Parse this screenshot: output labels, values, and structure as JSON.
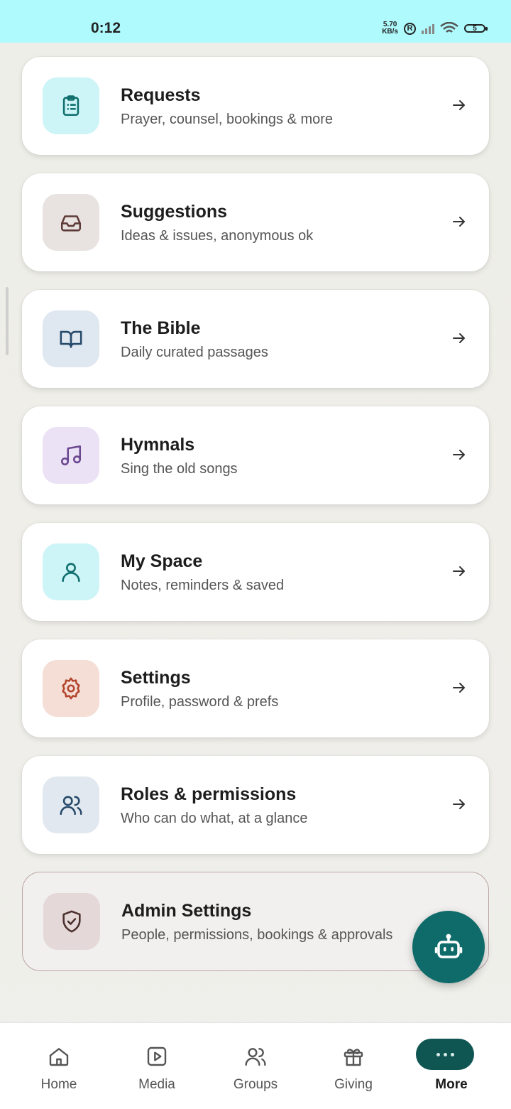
{
  "status_bar": {
    "time": "0:12",
    "speed_value": "5.70",
    "speed_unit": "KB/s",
    "r_badge": "R",
    "battery": "5"
  },
  "menu": [
    {
      "title": "Requests",
      "subtitle": "Prayer, counsel, bookings & more",
      "icon": "clipboard-icon",
      "tile_color": "#cdf4f7",
      "icon_color": "#0f6f6d"
    },
    {
      "title": "Suggestions",
      "subtitle": "Ideas & issues, anonymous ok",
      "icon": "inbox-icon",
      "tile_color": "#e8e3e1",
      "icon_color": "#5d3a37"
    },
    {
      "title": "The Bible",
      "subtitle": "Daily curated passages",
      "icon": "book-icon",
      "tile_color": "#dfe7f0",
      "icon_color": "#274a6b"
    },
    {
      "title": "Hymnals",
      "subtitle": "Sing the old songs",
      "icon": "music-note-icon",
      "tile_color": "#ebe2f5",
      "icon_color": "#6b4790"
    },
    {
      "title": "My Space",
      "subtitle": "Notes, reminders & saved",
      "icon": "user-icon",
      "tile_color": "#cdf4f7",
      "icon_color": "#0f6f6d"
    },
    {
      "title": "Settings",
      "subtitle": "Profile, password & prefs",
      "icon": "gear-icon",
      "tile_color": "#f4ded6",
      "icon_color": "#b3452c"
    },
    {
      "title": "Roles & permissions",
      "subtitle": "Who can do what, at a glance",
      "icon": "users-icon",
      "tile_color": "#e2e8ef",
      "icon_color": "#274a6b"
    },
    {
      "title": "Admin Settings",
      "subtitle": "People, permissions, bookings & approvals",
      "icon": "shield-check-icon",
      "tile_color": "#e4d9d8",
      "icon_color": "#4b2f2d"
    }
  ],
  "fab": {
    "icon": "robot-icon",
    "color": "#0e6b6a"
  },
  "bottom_nav": [
    {
      "label": "Home",
      "icon": "home-icon"
    },
    {
      "label": "Media",
      "icon": "play-icon"
    },
    {
      "label": "Groups",
      "icon": "users-icon"
    },
    {
      "label": "Giving",
      "icon": "gift-icon"
    },
    {
      "label": "More",
      "icon": "more-dots-icon",
      "active": true
    }
  ]
}
